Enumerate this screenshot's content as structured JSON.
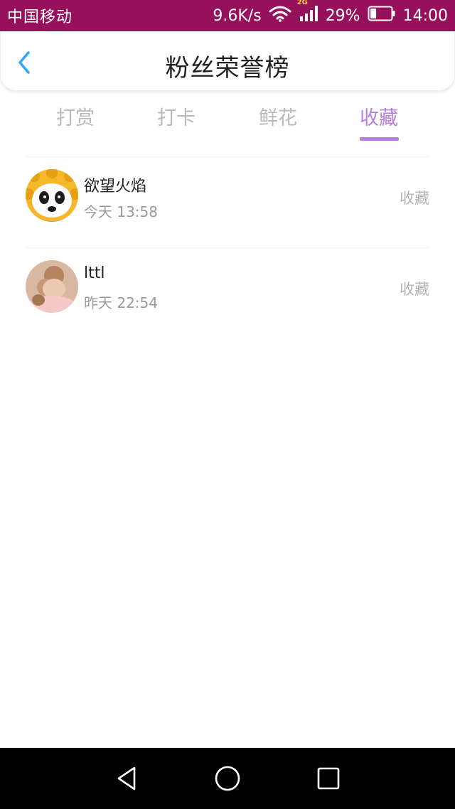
{
  "status_bar": {
    "carrier": "中国移动",
    "speed": "9.6K/s",
    "network": "2G",
    "battery": "29%",
    "time": "14:00",
    "battery_level": 0.29
  },
  "header": {
    "title": "粉丝荣誉榜",
    "back_icon": "chevron-left-icon"
  },
  "tabs": [
    {
      "label": "打赏",
      "active": false
    },
    {
      "label": "打卡",
      "active": false
    },
    {
      "label": "鲜花",
      "active": false
    },
    {
      "label": "收藏",
      "active": true
    }
  ],
  "items": [
    {
      "name": "欲望火焰",
      "time": "今天 13:58",
      "action": "收藏"
    },
    {
      "name": "lttl",
      "time": "昨天 22:54",
      "action": "收藏"
    }
  ],
  "colors": {
    "status_bar": "#96105c",
    "accent": "#b57fe0",
    "back_icon": "#2ea8f2"
  },
  "nav": {
    "icons": [
      "back-triangle-icon",
      "home-circle-icon",
      "recents-square-icon"
    ]
  }
}
